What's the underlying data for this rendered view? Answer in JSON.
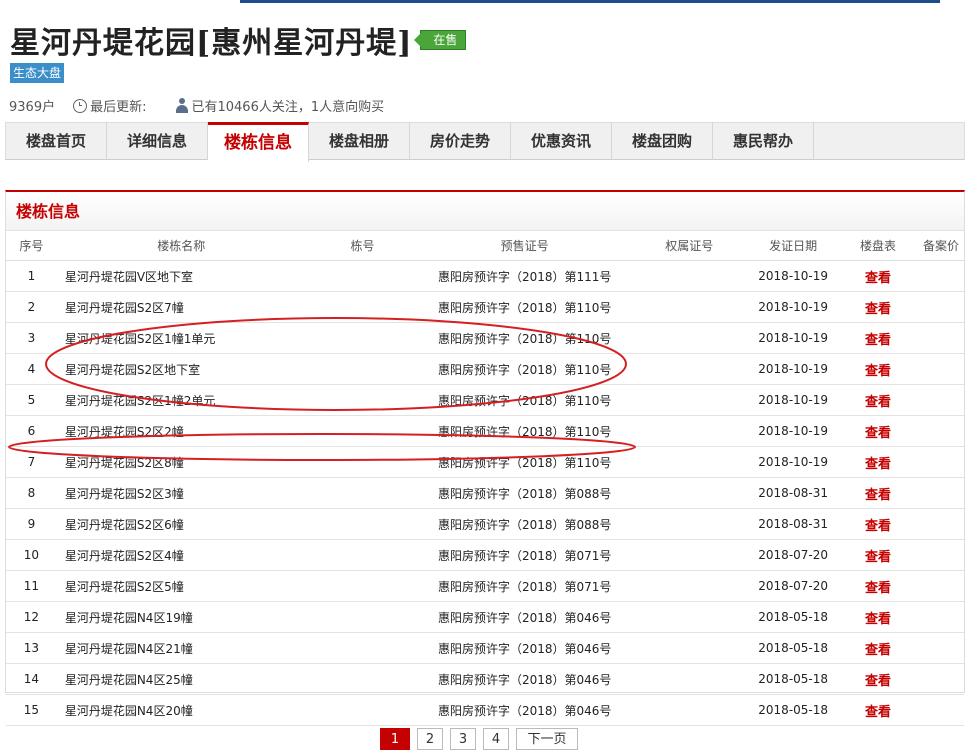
{
  "header": {
    "title": "星河丹堤花园[惠州星河丹堤]",
    "sale_status": "在售",
    "tag": "生态大盘",
    "households": "9369户",
    "last_updated_label": "最后更新:",
    "followers_text": "已有10466人关注，1人意向购买"
  },
  "nav": {
    "tabs": [
      {
        "label": "楼盘首页",
        "active": false
      },
      {
        "label": "详细信息",
        "active": false
      },
      {
        "label": "楼栋信息",
        "active": true
      },
      {
        "label": "楼盘相册",
        "active": false
      },
      {
        "label": "房价走势",
        "active": false
      },
      {
        "label": "优惠资讯",
        "active": false
      },
      {
        "label": "楼盘团购",
        "active": false
      },
      {
        "label": "惠民帮办",
        "active": false
      }
    ]
  },
  "section": {
    "title": "楼栋信息",
    "columns": [
      "序号",
      "楼栋名称",
      "栋号",
      "预售证号",
      "权属证号",
      "发证日期",
      "楼盘表",
      "备案价"
    ],
    "rows": [
      {
        "no": "1",
        "name": "星河丹堤花园V区地下室",
        "building": "",
        "presale": "惠阳房预许字（2018）第111号",
        "title_cert": "",
        "date": "2018-10-19",
        "view": "查看",
        "price": ""
      },
      {
        "no": "2",
        "name": "星河丹堤花园S2区7幢",
        "building": "",
        "presale": "惠阳房预许字（2018）第110号",
        "title_cert": "",
        "date": "2018-10-19",
        "view": "查看",
        "price": ""
      },
      {
        "no": "3",
        "name": "星河丹堤花园S2区1幢1单元",
        "building": "",
        "presale": "惠阳房预许字（2018）第110号",
        "title_cert": "",
        "date": "2018-10-19",
        "view": "查看",
        "price": ""
      },
      {
        "no": "4",
        "name": "星河丹堤花园S2区地下室",
        "building": "",
        "presale": "惠阳房预许字（2018）第110号",
        "title_cert": "",
        "date": "2018-10-19",
        "view": "查看",
        "price": ""
      },
      {
        "no": "5",
        "name": "星河丹堤花园S2区1幢2单元",
        "building": "",
        "presale": "惠阳房预许字（2018）第110号",
        "title_cert": "",
        "date": "2018-10-19",
        "view": "查看",
        "price": ""
      },
      {
        "no": "6",
        "name": "星河丹堤花园S2区2幢",
        "building": "",
        "presale": "惠阳房预许字（2018）第110号",
        "title_cert": "",
        "date": "2018-10-19",
        "view": "查看",
        "price": ""
      },
      {
        "no": "7",
        "name": "星河丹堤花园S2区8幢",
        "building": "",
        "presale": "惠阳房预许字（2018）第110号",
        "title_cert": "",
        "date": "2018-10-19",
        "view": "查看",
        "price": ""
      },
      {
        "no": "8",
        "name": "星河丹堤花园S2区3幢",
        "building": "",
        "presale": "惠阳房预许字（2018）第088号",
        "title_cert": "",
        "date": "2018-08-31",
        "view": "查看",
        "price": ""
      },
      {
        "no": "9",
        "name": "星河丹堤花园S2区6幢",
        "building": "",
        "presale": "惠阳房预许字（2018）第088号",
        "title_cert": "",
        "date": "2018-08-31",
        "view": "查看",
        "price": ""
      },
      {
        "no": "10",
        "name": "星河丹堤花园S2区4幢",
        "building": "",
        "presale": "惠阳房预许字（2018）第071号",
        "title_cert": "",
        "date": "2018-07-20",
        "view": "查看",
        "price": ""
      },
      {
        "no": "11",
        "name": "星河丹堤花园S2区5幢",
        "building": "",
        "presale": "惠阳房预许字（2018）第071号",
        "title_cert": "",
        "date": "2018-07-20",
        "view": "查看",
        "price": ""
      },
      {
        "no": "12",
        "name": "星河丹堤花园N4区19幢",
        "building": "",
        "presale": "惠阳房预许字（2018）第046号",
        "title_cert": "",
        "date": "2018-05-18",
        "view": "查看",
        "price": ""
      },
      {
        "no": "13",
        "name": "星河丹堤花园N4区21幢",
        "building": "",
        "presale": "惠阳房预许字（2018）第046号",
        "title_cert": "",
        "date": "2018-05-18",
        "view": "查看",
        "price": ""
      },
      {
        "no": "14",
        "name": "星河丹堤花园N4区25幢",
        "building": "",
        "presale": "惠阳房预许字（2018）第046号",
        "title_cert": "",
        "date": "2018-05-18",
        "view": "查看",
        "price": ""
      },
      {
        "no": "15",
        "name": "星河丹堤花园N4区20幢",
        "building": "",
        "presale": "惠阳房预许字（2018）第046号",
        "title_cert": "",
        "date": "2018-05-18",
        "view": "查看",
        "price": ""
      }
    ]
  },
  "pagination": {
    "pages": [
      "1",
      "2",
      "3",
      "4"
    ],
    "current": "1",
    "next_label": "下一页"
  },
  "colors": {
    "accent_red": "#c40000",
    "annotation_red": "#d42020",
    "sale_green": "#4aa53a",
    "tag_blue": "#3a8fc9"
  }
}
